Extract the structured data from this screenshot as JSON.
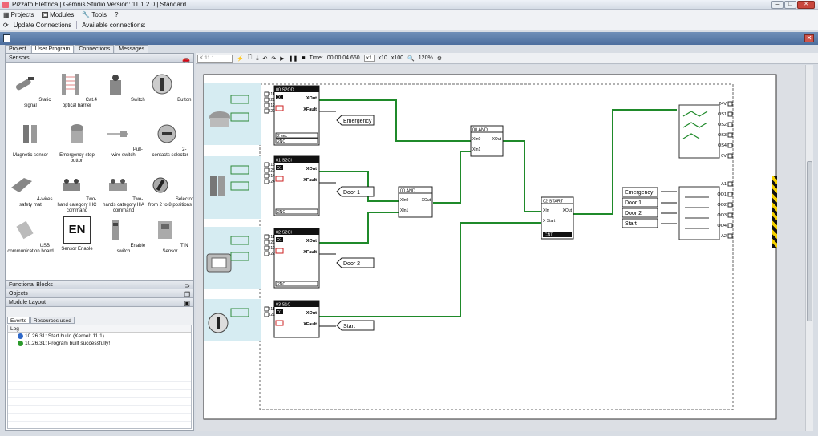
{
  "window": {
    "title": "Pizzato Elettrica  |  Gemnis Studio  Version: 11.1.2.0  |  Standard"
  },
  "menu": [
    {
      "label": "Projects",
      "icon": "grid-icon"
    },
    {
      "label": "Modules",
      "icon": "module-icon"
    },
    {
      "label": "Tools",
      "icon": "wrench-icon"
    },
    {
      "label": "?",
      "icon": ""
    }
  ],
  "toolbar": {
    "update": "Update Connections",
    "available": "Available connections:"
  },
  "tabs": [
    "Project",
    "User Program",
    "Connections",
    "Messages"
  ],
  "sensors": {
    "header": "Sensors",
    "items": [
      "Static signal",
      "Cat.4 optical barrier",
      "Switch",
      "Button",
      "Magnetic sensor",
      "Emergency-stop button",
      "Pull-wire switch",
      "2-contacts selector",
      "4-wires safety mat",
      "Two-hand category IIIC command",
      "Two-hands category IIIA command",
      "Selector from 2 to 8 positions",
      "USB communication board",
      "Sensor Enable",
      "Enable switch",
      "TIN Sensor"
    ]
  },
  "sections": [
    "Functional Blocks",
    "Objects",
    "Module Layout"
  ],
  "events": {
    "tabs": [
      "Events",
      "Resources used"
    ],
    "col": "Log",
    "rows": [
      "10.26.31: Start build (Kernel: 11.1).",
      "10.26.31: Program built successfully!"
    ]
  },
  "editor": {
    "kernel": "K 11.1",
    "time_label": "Time:",
    "time": "00:00:04.660",
    "speeds": [
      "x1",
      "x10",
      "x100"
    ],
    "zoom": "120%"
  },
  "blocks": [
    {
      "id": "00 S2OD",
      "type": "O1",
      "out": "XOut",
      "fault": "XFault",
      "ins": [
        "I11",
        "I21",
        "I12",
        "I22"
      ],
      "foot": [
        "2 sec",
        "2NC"
      ]
    },
    {
      "id": "01 S2CI",
      "type": "O1",
      "out": "XOut",
      "fault": "XFault",
      "ins": [
        "I13",
        "I23",
        "I14",
        "I24"
      ],
      "foot": [
        "2NC"
      ]
    },
    {
      "id": "02 S2CI",
      "type": "O1",
      "out": "XOut",
      "fault": "XFault",
      "ins": [
        "I11",
        "I21",
        "I12",
        "I22"
      ],
      "foot": [
        "2NC"
      ]
    },
    {
      "id": "03 S1C",
      "type": "O1",
      "out": "XOut",
      "fault": "XFault",
      "ins": [
        "I11",
        "I21"
      ],
      "foot": []
    }
  ],
  "logic": {
    "and1": {
      "id": "00 AND",
      "in": [
        "XIn0",
        "XIn1"
      ],
      "out": "XOut"
    },
    "and2": {
      "id": "00 AND",
      "in": [
        "XIn0",
        "XIn1"
      ],
      "out": "XOut"
    },
    "start": {
      "id": "02 START",
      "in": [
        "XIn",
        "X Start"
      ],
      "out": "XOut",
      "foot": "CNT"
    }
  },
  "outputs_fault": [
    "Emergency",
    "Door 1",
    "Door 2",
    "Start"
  ],
  "outputs_top": {
    "labels": [
      "24V",
      "OS1",
      "OS2",
      "OS3",
      "OS4",
      "0V"
    ]
  },
  "outputs_bottom": {
    "labels": [
      "A1",
      "OO1",
      "OO2",
      "OO3",
      "OO4",
      "A2"
    ],
    "tags": [
      "Emergency",
      "Door 1",
      "Door 2",
      "Start"
    ]
  },
  "colors": {
    "wire": "#1f8a2a",
    "accent": "#4c6e9e"
  }
}
